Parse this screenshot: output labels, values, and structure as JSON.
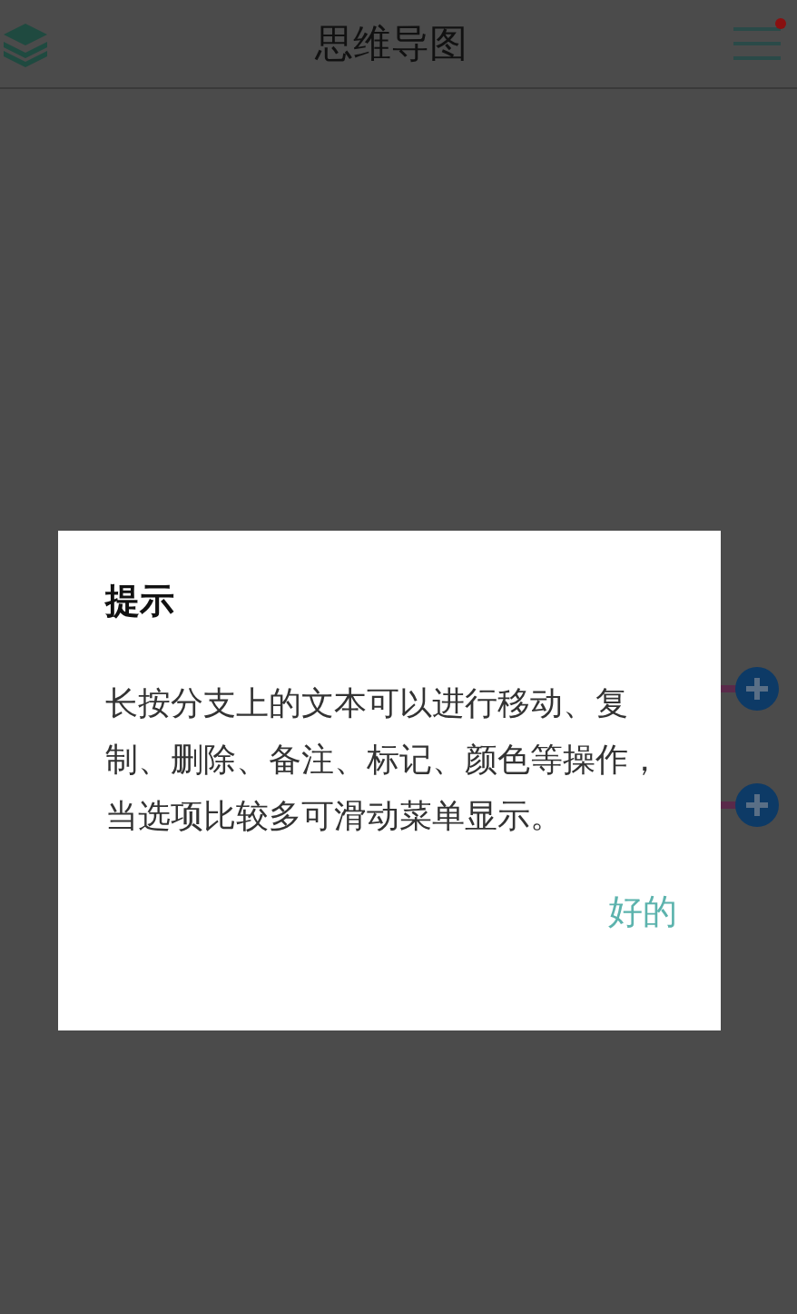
{
  "header": {
    "title": "思维导图",
    "menu_badge": true
  },
  "dialog": {
    "title": "提示",
    "message": "长按分支上的文本可以进行移动、复制、删除、备注、标记、颜色等操作，当选项比较多可滑动菜单显示。",
    "button": "好的"
  }
}
